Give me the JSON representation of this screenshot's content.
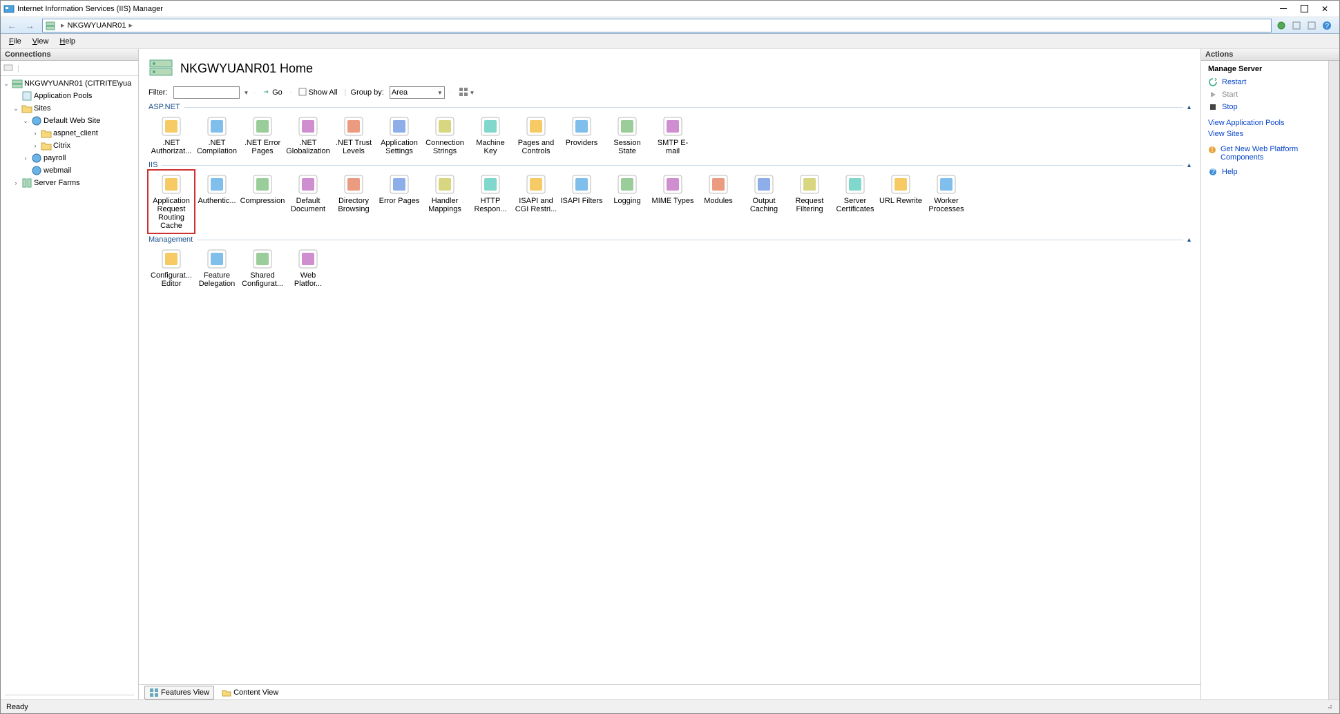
{
  "window": {
    "title": "Internet Information Services (IIS) Manager"
  },
  "address": {
    "server": "NKGWYUANR01"
  },
  "menu": {
    "file": "File",
    "view": "View",
    "help": "Help"
  },
  "connections": {
    "header": "Connections",
    "tree": {
      "server": "NKGWYUANR01 (CITRITE\\yua",
      "app_pools": "Application Pools",
      "sites": "Sites",
      "default_site": "Default Web Site",
      "aspnet_client": "aspnet_client",
      "citrix": "Citrix",
      "payroll": "payroll",
      "webmail": "webmail",
      "server_farms": "Server Farms"
    }
  },
  "center": {
    "title": "NKGWYUANR01 Home",
    "filter_label": "Filter:",
    "go": "Go",
    "show_all": "Show All",
    "group_by": "Group by:",
    "group_by_value": "Area",
    "groups": {
      "aspnet": {
        "title": "ASP.NET",
        "items": [
          ".NET Authorizat...",
          ".NET Compilation",
          ".NET Error Pages",
          ".NET Globalization",
          ".NET Trust Levels",
          "Application Settings",
          "Connection Strings",
          "Machine Key",
          "Pages and Controls",
          "Providers",
          "Session State",
          "SMTP E-mail"
        ]
      },
      "iis": {
        "title": "IIS",
        "items": [
          "Application Request Routing Cache",
          "Authentic...",
          "Compression",
          "Default Document",
          "Directory Browsing",
          "Error Pages",
          "Handler Mappings",
          "HTTP Respon...",
          "ISAPI and CGI Restri...",
          "ISAPI Filters",
          "Logging",
          "MIME Types",
          "Modules",
          "Output Caching",
          "Request Filtering",
          "Server Certificates",
          "URL Rewrite",
          "Worker Processes"
        ]
      },
      "management": {
        "title": "Management",
        "items": [
          "Configurat... Editor",
          "Feature Delegation",
          "Shared Configurat...",
          "Web Platfor..."
        ]
      }
    },
    "tabs": {
      "features": "Features View",
      "content": "Content View"
    }
  },
  "actions": {
    "header": "Actions",
    "manage_server": "Manage Server",
    "restart": "Restart",
    "start": "Start",
    "stop": "Stop",
    "view_app_pools": "View Application Pools",
    "view_sites": "View Sites",
    "get_platform": "Get New Web Platform Components",
    "help": "Help"
  },
  "status": {
    "ready": "Ready"
  }
}
